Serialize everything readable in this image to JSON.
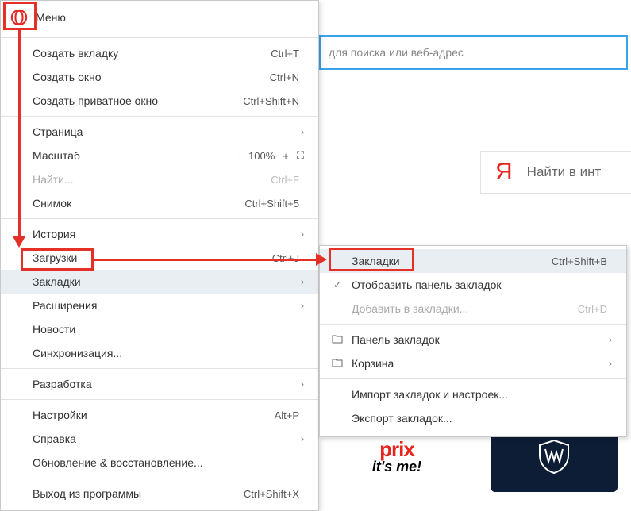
{
  "header": {
    "menu_label": "Меню"
  },
  "address_bar": {
    "placeholder": "для поиска или веб-адрес"
  },
  "search": {
    "logo": "Я",
    "placeholder": "Найти в инт"
  },
  "tiles": {
    "prix_word": "prix",
    "prix_script": "it's me!"
  },
  "menu": {
    "items": {
      "new_tab": {
        "label": "Создать вкладку",
        "shortcut": "Ctrl+T"
      },
      "new_window": {
        "label": "Создать окно",
        "shortcut": "Ctrl+N"
      },
      "new_private": {
        "label": "Создать приватное окно",
        "shortcut": "Ctrl+Shift+N"
      },
      "page": {
        "label": "Страница"
      },
      "zoom": {
        "label": "Масштаб",
        "minus": "−",
        "value": "100%",
        "plus": "+",
        "full_icon": "⛶"
      },
      "find": {
        "label": "Найти...",
        "shortcut": "Ctrl+F"
      },
      "snapshot": {
        "label": "Снимок",
        "shortcut": "Ctrl+Shift+5"
      },
      "history": {
        "label": "История"
      },
      "downloads": {
        "label": "Загрузки",
        "shortcut": "Ctrl+J"
      },
      "bookmarks": {
        "label": "Закладки"
      },
      "extensions": {
        "label": "Расширения"
      },
      "news": {
        "label": "Новости"
      },
      "sync": {
        "label": "Синхронизация..."
      },
      "dev": {
        "label": "Разработка"
      },
      "settings": {
        "label": "Настройки",
        "shortcut": "Alt+P"
      },
      "help": {
        "label": "Справка"
      },
      "update": {
        "label": "Обновление & восстановление..."
      },
      "exit": {
        "label": "Выход из программы",
        "shortcut": "Ctrl+Shift+X"
      }
    }
  },
  "submenu": {
    "items": {
      "bookmarks": {
        "label": "Закладки",
        "shortcut": "Ctrl+Shift+B"
      },
      "show_bar": {
        "label": "Отобразить панель закладок"
      },
      "add": {
        "label": "Добавить в закладки...",
        "shortcut": "Ctrl+D"
      },
      "panel": {
        "label": "Панель закладок"
      },
      "trash": {
        "label": "Корзина"
      },
      "import": {
        "label": "Импорт закладок и настроек..."
      },
      "export": {
        "label": "Экспорт закладок..."
      }
    }
  }
}
